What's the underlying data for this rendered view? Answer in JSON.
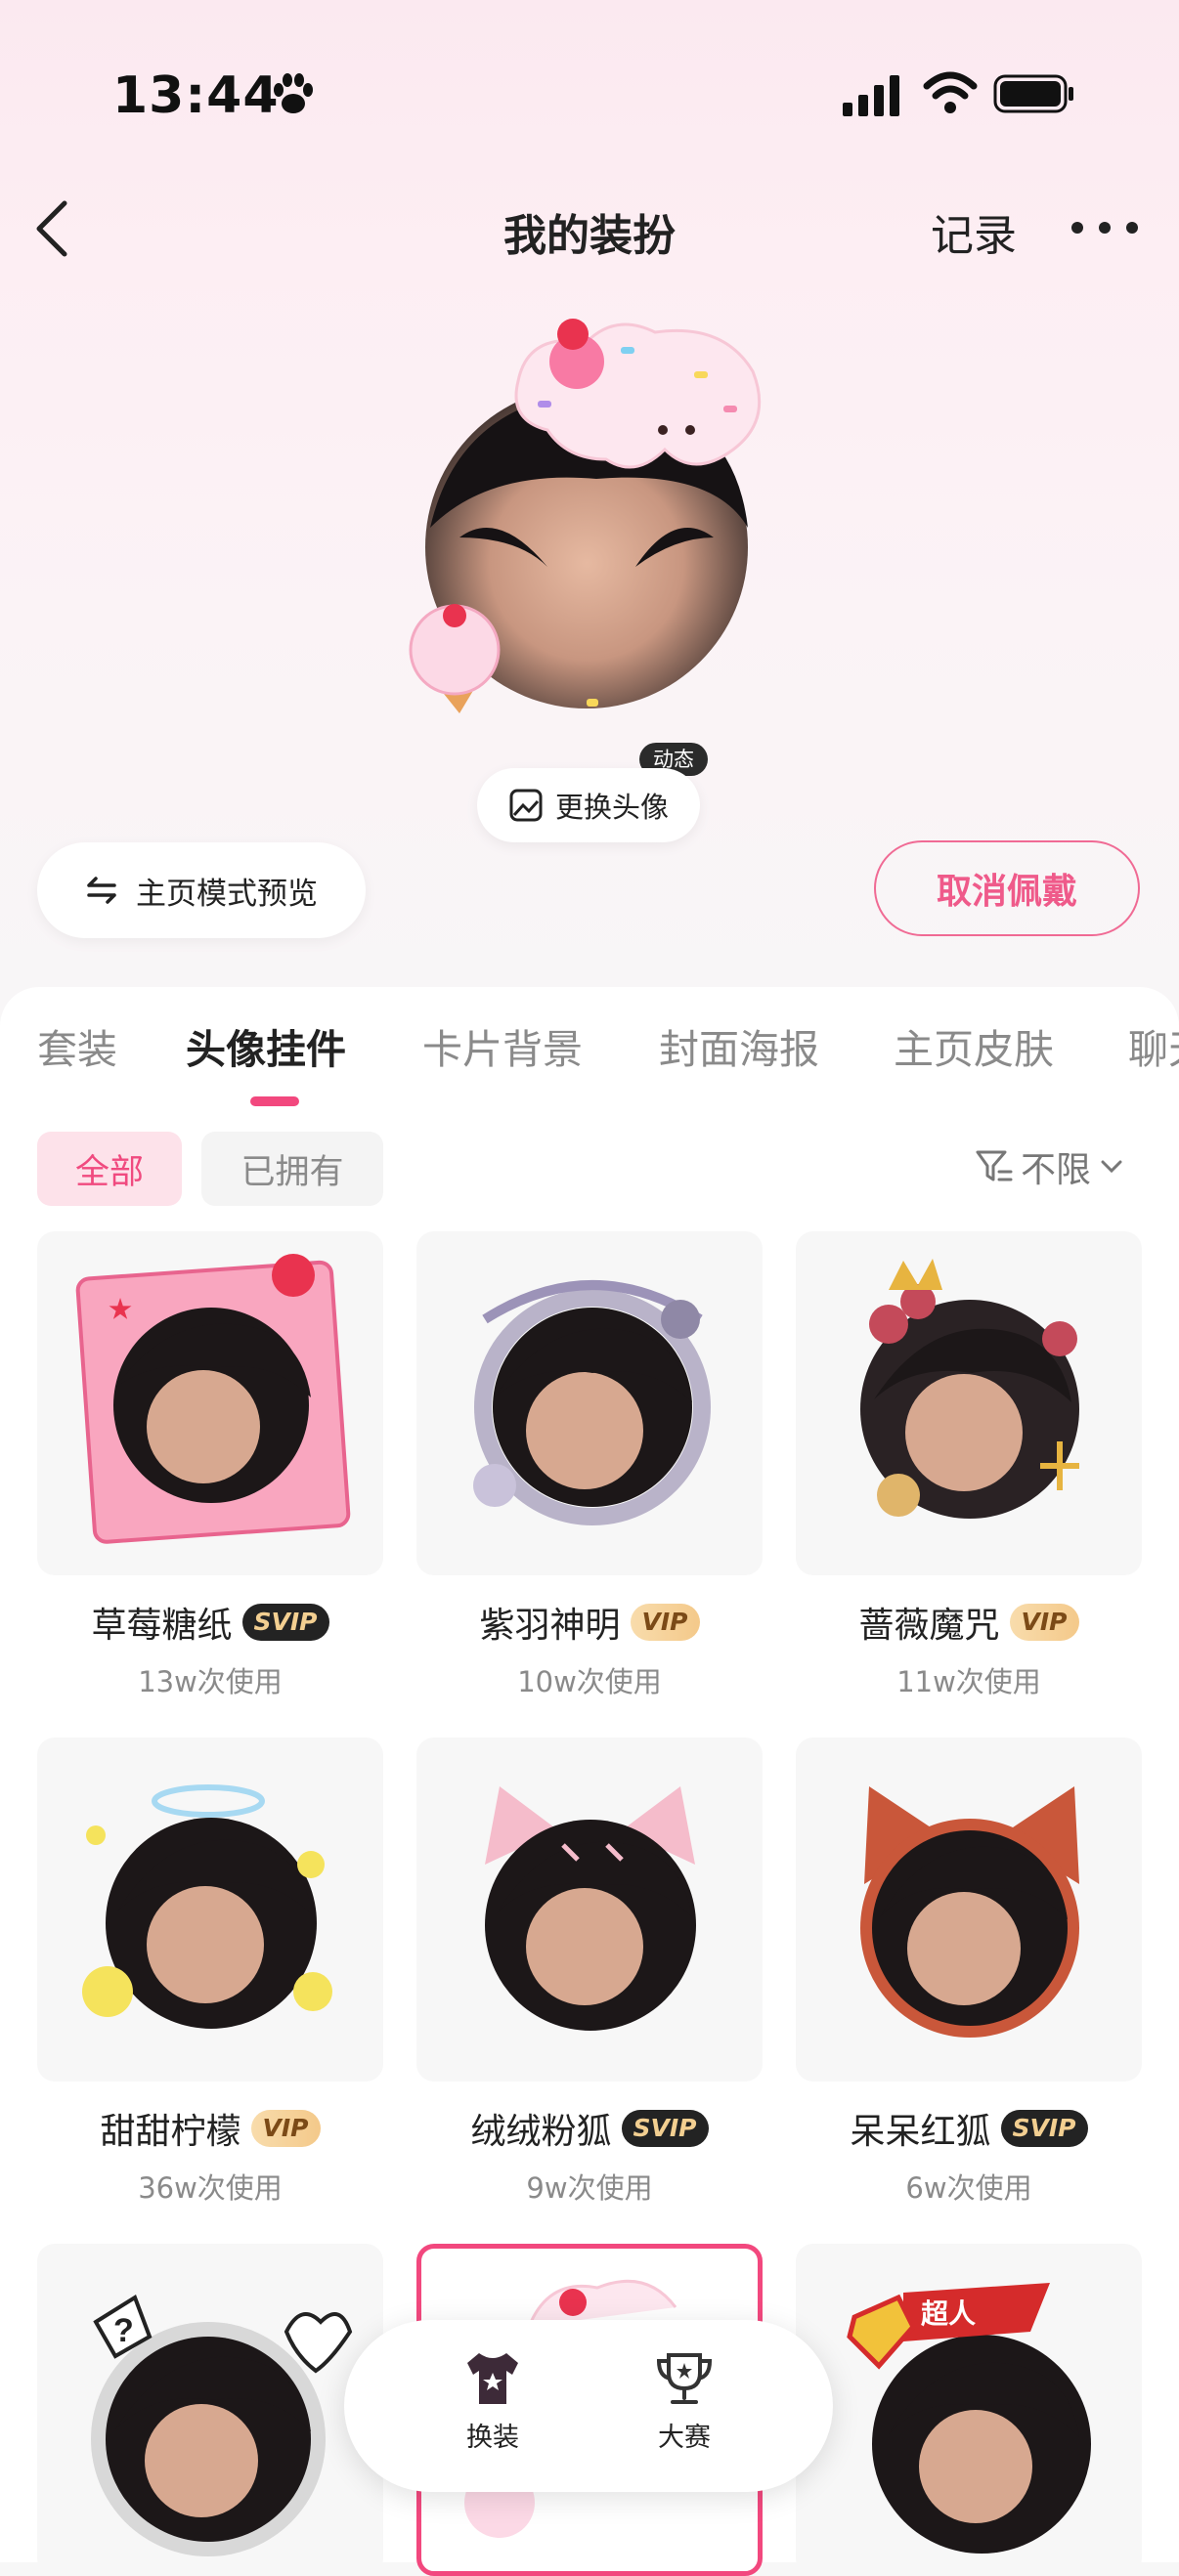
{
  "status_bar": {
    "time": "13:44"
  },
  "nav": {
    "title": "我的装扮",
    "record": "记录"
  },
  "avatar": {
    "dynamic_badge": "动态",
    "change_label": "更换头像"
  },
  "actions": {
    "preview": "主页模式预览",
    "cancel": "取消佩戴"
  },
  "tabs": [
    "套装",
    "头像挂件",
    "卡片背景",
    "封面海报",
    "主页皮肤",
    "聊天"
  ],
  "filters": {
    "all": "全部",
    "owned": "已拥有",
    "sort": "不限"
  },
  "items": [
    {
      "name": "草莓糖纸",
      "badge": "SVIP",
      "usage": "13w次使用"
    },
    {
      "name": "紫羽神明",
      "badge": "VIP",
      "usage": "10w次使用"
    },
    {
      "name": "蔷薇魔咒",
      "badge": "VIP",
      "usage": "11w次使用"
    },
    {
      "name": "甜甜柠檬",
      "badge": "VIP",
      "usage": "36w次使用"
    },
    {
      "name": "绒绒粉狐",
      "badge": "SVIP",
      "usage": "9w次使用"
    },
    {
      "name": "呆呆红狐",
      "badge": "SVIP",
      "usage": "6w次使用"
    }
  ],
  "superhero_tag": "超人",
  "bottom_nav": [
    {
      "label": "换装"
    },
    {
      "label": "大赛"
    }
  ],
  "colors": {
    "accent": "#f2487e",
    "svip_bg": "#232323",
    "vip_bg": "#f4c98a"
  }
}
